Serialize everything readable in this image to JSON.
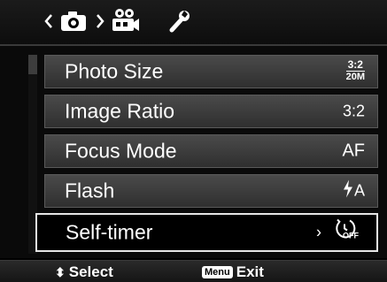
{
  "tabs": [
    {
      "icon": "chevron-left-icon"
    },
    {
      "icon": "camera-icon"
    },
    {
      "icon": "chevron-right-icon"
    },
    {
      "icon": "movie-camera-icon"
    },
    {
      "icon": "wrench-icon"
    }
  ],
  "menu": {
    "items": [
      {
        "label": "Photo Size",
        "value_top": "3:2",
        "value_bottom": "20M"
      },
      {
        "label": "Image Ratio",
        "value": "3:2"
      },
      {
        "label": "Focus Mode",
        "value": "AF"
      },
      {
        "label": "Flash",
        "value": "A",
        "value_icon": "flash-icon"
      },
      {
        "label": "Self-timer",
        "arrow": "›",
        "value": "OFF",
        "value_icon": "self-timer-icon",
        "selected": true
      }
    ]
  },
  "footer": {
    "select_label": "Select",
    "menu_key": "Menu",
    "exit_label": "Exit"
  },
  "colors": {
    "row_gradient_top": "#4a4a4a",
    "row_gradient_bottom": "#2f2f2f",
    "selection_border": "#e6e6e6"
  }
}
